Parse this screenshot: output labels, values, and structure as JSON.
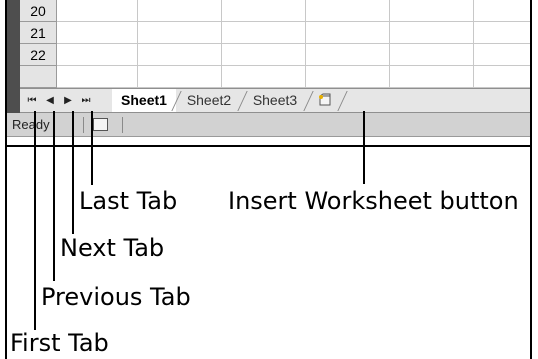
{
  "rows": [
    "20",
    "21",
    "22"
  ],
  "nav_buttons": [
    {
      "name": "first-tab-button",
      "glyph": "⏮"
    },
    {
      "name": "previous-tab-button",
      "glyph": "◀"
    },
    {
      "name": "next-tab-button",
      "glyph": "▶"
    },
    {
      "name": "last-tab-button",
      "glyph": "⏭"
    }
  ],
  "tabs": [
    "Sheet1",
    "Sheet2",
    "Sheet3"
  ],
  "insert_icon": "insert-worksheet-icon",
  "status": {
    "text": "Ready"
  },
  "callouts": {
    "last_tab": "Last Tab",
    "insert_worksheet": "Insert Worksheet button",
    "next_tab": "Next Tab",
    "previous_tab": "Previous Tab",
    "first_tab": "First Tab"
  },
  "colors": {
    "grid": "#c8c8c8",
    "header": "#e4e4e4",
    "tabbar": "#e6e6e6",
    "statusbar": "#d2d2d2"
  }
}
